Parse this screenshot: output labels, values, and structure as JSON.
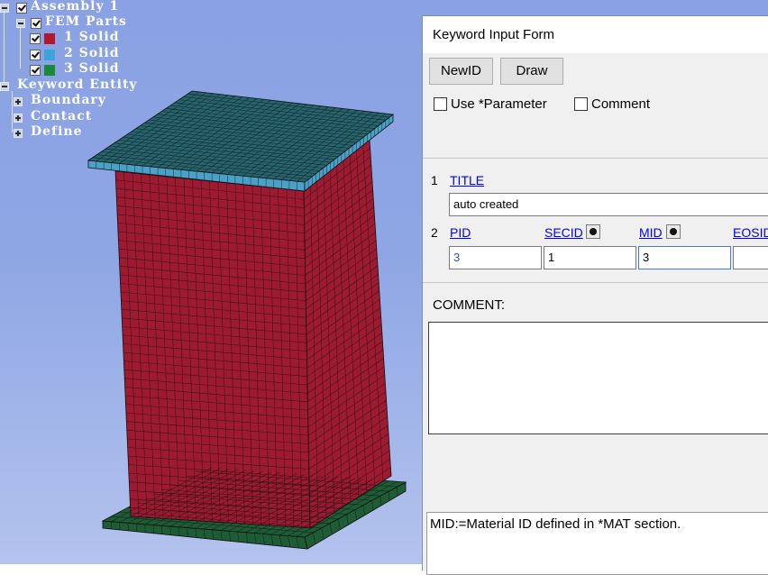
{
  "tree": {
    "assembly": "Assembly 1",
    "fem_parts": "FEM Parts",
    "parts": [
      {
        "label": "1 Solid",
        "color": "#b2182b"
      },
      {
        "label": "2 Solid",
        "color": "#3aa6d8"
      },
      {
        "label": "3 Solid",
        "color": "#1a8a3a"
      }
    ],
    "keyword_entity": "Keyword Entity",
    "children": [
      "Boundary",
      "Contact",
      "Define"
    ]
  },
  "model": {
    "top_plate_color": "#26656e",
    "top_plate_edge_color": "#4aa1c7",
    "column_color": "#9e1a30",
    "base_plate_color": "#1d5c34",
    "mesh_line_color": "#111111"
  },
  "dialog": {
    "title": "Keyword Input Form",
    "buttons": {
      "newid": "NewID",
      "draw": "Draw"
    },
    "checkboxes": {
      "use_parameter": "Use *Parameter",
      "comment": "Comment"
    },
    "row1": {
      "num": "1",
      "title_link": "TITLE",
      "title_value": "auto created"
    },
    "row2": {
      "num": "2",
      "pid_label": "PID",
      "pid_value": "3",
      "secid_label": "SECID",
      "secid_value": "1",
      "mid_label": "MID",
      "mid_value": "3",
      "eosid_label": "EOSID",
      "eosid_value": ""
    },
    "comment_label": "COMMENT:",
    "comment_text": "",
    "help_text": "MID:=Material ID defined in *MAT section."
  }
}
